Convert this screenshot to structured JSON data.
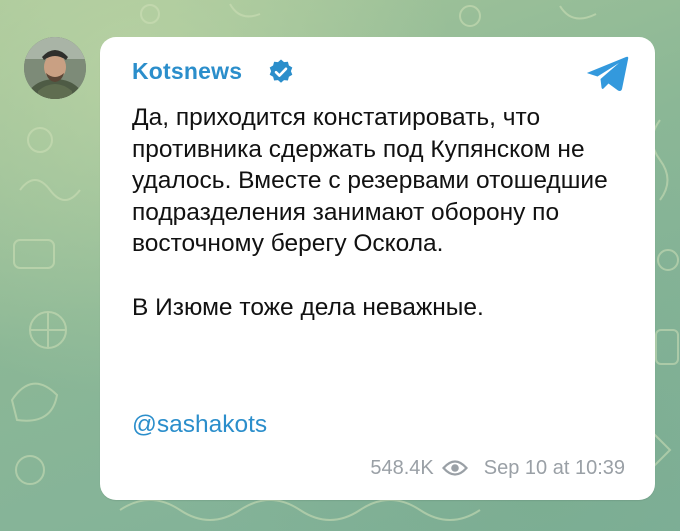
{
  "post": {
    "channel_name": "Kotsnews",
    "verified_icon": "verified-badge-icon",
    "app_icon": "telegram-icon",
    "avatar_icon": "channel-avatar",
    "paragraphs": [
      "Да, приходится констатировать, что противника сдержать под Купянском не удалось. Вместе с резервами отошедшие подразделения занимают оборону по восточному берегу Оскола.",
      "В Изюме тоже дела неважные."
    ],
    "mention": "@sashakots",
    "views": "548.4K",
    "views_icon": "eye-icon",
    "timestamp": "Sep 10 at 10:39"
  },
  "colors": {
    "accent": "#2b8ecb",
    "bubble": "#ffffff",
    "text": "#111111",
    "meta": "#9aa0a6",
    "wallpaper": "#8fb89a"
  }
}
